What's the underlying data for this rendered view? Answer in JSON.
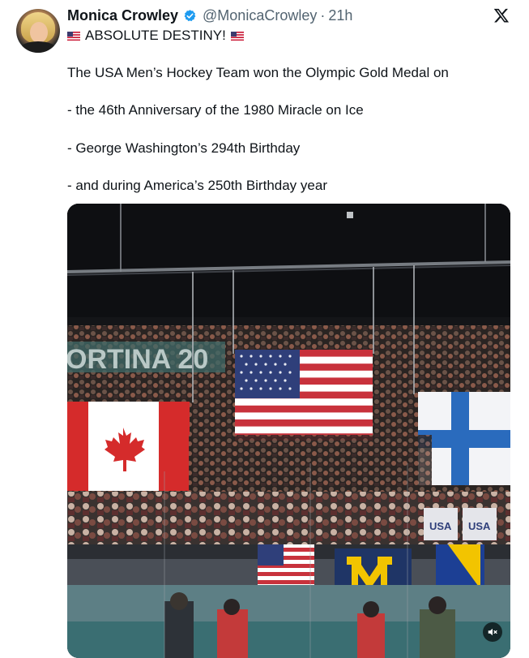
{
  "post": {
    "author": {
      "name": "Monica Crowley",
      "handle": "@MonicaCrowley",
      "separator": "·",
      "time": "21h"
    },
    "headline": "ABSOLUTE DESTINY!",
    "lines": [
      "The USA Men’s Hockey Team won the Olympic Gold Medal on",
      "- the 46th Anniversary of the 1980 Miracle on Ice",
      "- George Washington’s 294th Birthday",
      "- and during America’s 250th Birthday year"
    ],
    "media": {
      "banner_text": "ORTINA 20",
      "jersey_text_1": "USA",
      "jersey_text_2": "USA"
    }
  },
  "icons": {
    "verified": "verified-badge-icon",
    "brand": "x-logo-icon",
    "flag": "us-flag-icon",
    "mute": "speaker-muted-icon"
  },
  "colors": {
    "text": "#0f1419",
    "secondary": "#536471",
    "verified": "#1d9bf0"
  }
}
